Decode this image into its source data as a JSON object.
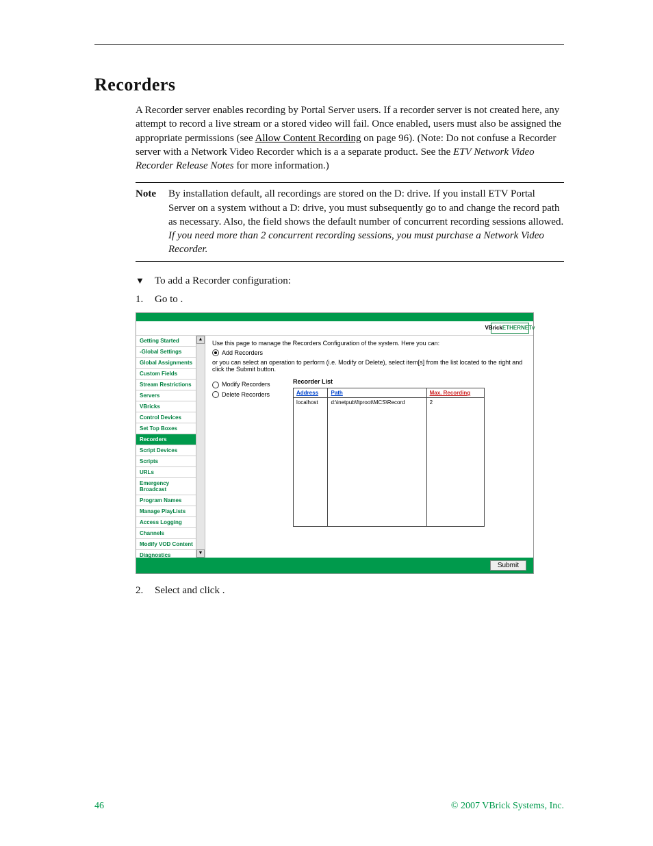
{
  "heading": "Recorders",
  "intro_1": "A Recorder server enables recording by Portal Server users. If a recorder server is not created here, any attempt to record a live stream or a stored video will fail. Once enabled, users must also be assigned the appropriate permissions (see ",
  "intro_link": "Allow Content Recording",
  "intro_2": " on page 96). (Note: Do not confuse a Recorder server with a Network Video Recorder which is a a separate product. See the ",
  "intro_em": "ETV Network Video Recorder Release Notes",
  "intro_3": " for more information.)",
  "note_label": "Note",
  "note_body_1": "By installation default, all recordings are stored on the D: drive. If you install ETV Portal Server on a system without a D: drive, you must subsequently go to ",
  "note_body_2": " and change the record path as necessary. Also, the ",
  "note_body_3": " field shows the default number of concurrent recording sessions allowed. ",
  "note_em": "If you need more than 2 concurrent recording sessions, you must purchase a Network Video Recorder.",
  "proc_title": "To add a Recorder configuration:",
  "step1_label": "1.",
  "step1_text": "Go to ",
  "step1_tail": ".",
  "step2_label": "2.",
  "step2_a": "Select ",
  "step2_b": " and click ",
  "step2_c": ".",
  "footer_page": "46",
  "footer_copy": "© 2007 VBrick Systems, Inc.",
  "shot": {
    "brand_a": "VBrick",
    "brand_b": "ETHERNETv",
    "intro": "Use this page to manage the Recorders Configuration of the system. Here you can:",
    "opt_add": "Add Recorders",
    "hint": "or you can select an operation to perform (i.e. Modify or Delete), select item[s] from the list located to the right and click the Submit button.",
    "opt_mod": "Modify Recorders",
    "opt_del": "Delete Recorders",
    "list_title": "Recorder List",
    "col_addr": "Address",
    "col_path": "Path",
    "col_max": "Max. Recording",
    "row_addr": "localhost",
    "row_path": "d:\\inetpub\\ftproot\\MCS\\Record",
    "row_max": "2",
    "submit": "Submit",
    "side": {
      "i0": "Getting Started",
      "i1": "-Global Settings",
      "i2": "Global Assignments",
      "i3": "Custom Fields",
      "i4": "Stream Restrictions",
      "i5": "Servers",
      "i6": "VBricks",
      "i7": "Control Devices",
      "i8": "Set Top Boxes",
      "i9": "Recorders",
      "i10": "Script Devices",
      "i11": "Scripts",
      "i12": "URLs",
      "i13": "Emergency Broadcast",
      "i14": "Program Names",
      "i15": "Manage PlayLists",
      "i16": "Access Logging",
      "i17": "Channels",
      "i18": "Modify VOD Content",
      "i19": "Diagnostics"
    }
  }
}
